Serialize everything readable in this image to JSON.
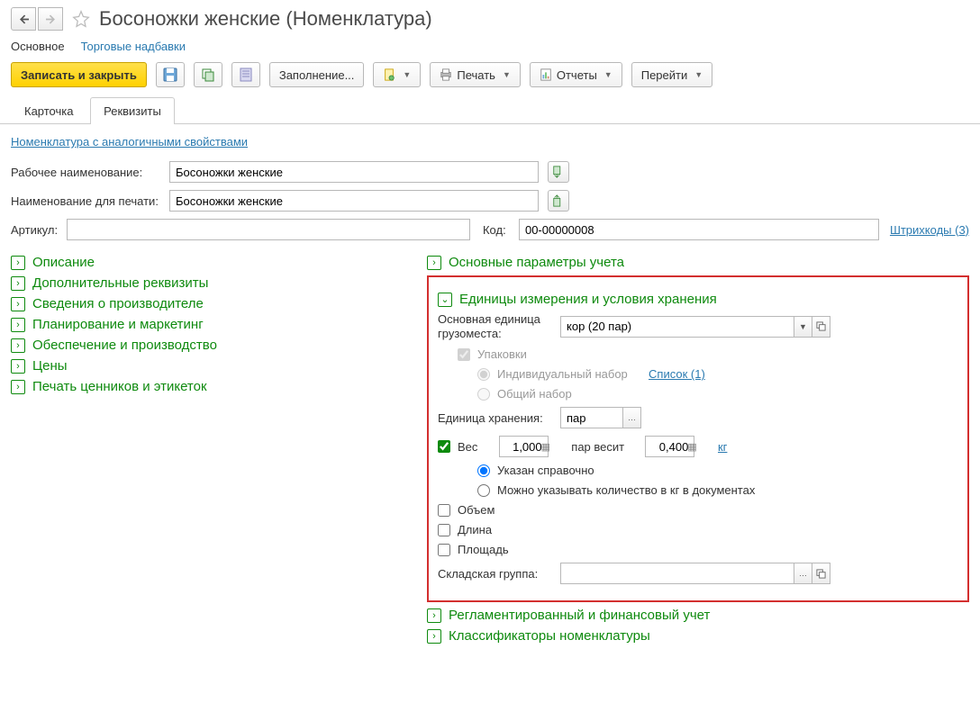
{
  "header": {
    "title": "Босоножки женские (Номенклатура)"
  },
  "navTabs": {
    "main": "Основное",
    "tradeMarkup": "Торговые надбавки"
  },
  "actions": {
    "saveClose": "Записать и закрыть",
    "fill": "Заполнение...",
    "print": "Печать",
    "reports": "Отчеты",
    "goto": "Перейти"
  },
  "subtabs": {
    "card": "Карточка",
    "requisites": "Реквизиты"
  },
  "links": {
    "similar": "Номенклатура с аналогичными свойствами",
    "barcodes": "Штрихкоды (3)",
    "setList": "Список (1)",
    "kg": "кг"
  },
  "fields": {
    "workName_lbl": "Рабочее наименование:",
    "workName_val": "Босоножки женские",
    "printName_lbl": "Наименование для печати:",
    "printName_val": "Босоножки женские",
    "article_lbl": "Артикул:",
    "article_val": "",
    "code_lbl": "Код:",
    "code_val": "00-00000008"
  },
  "sectionsLeft": [
    "Описание",
    "Дополнительные реквизиты",
    "Сведения о производителе",
    "Планирование и маркетинг",
    "Обеспечение и производство",
    "Цены",
    "Печать ценников и этикеток"
  ],
  "sectionsRight": {
    "mainParams": "Основные параметры учета",
    "units": "Единицы измерения и условия хранения",
    "regulated": "Регламентированный и финансовый учет",
    "classifiers": "Классификаторы номенклатуры"
  },
  "unitsBlock": {
    "baseUnit_lbl": "Основная единица грузоместа:",
    "baseUnit_val": "кор (20 пар)",
    "packs": "Упаковки",
    "indSet": "Индивидуальный набор",
    "commonSet": "Общий набор",
    "storageUnit_lbl": "Единица хранения:",
    "storageUnit_val": "пар",
    "weight_lbl": "Вес",
    "weight_qty": "1,000",
    "weight_mid": "пар весит",
    "weight_val": "0,400",
    "weight_r1": "Указан справочно",
    "weight_r2": "Можно указывать количество в кг в документах",
    "volume": "Объем",
    "length": "Длина",
    "area": "Площадь",
    "whGroup_lbl": "Складская группа:",
    "whGroup_val": ""
  }
}
